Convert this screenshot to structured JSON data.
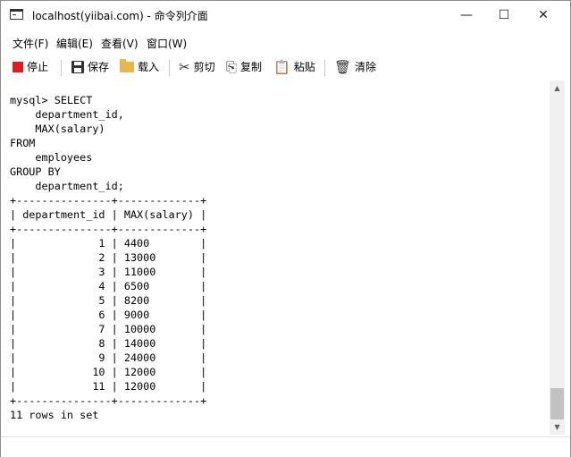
{
  "window": {
    "title": "localhost(yiibai.com) - 命令列介面",
    "minimize_glyph": "—",
    "maximize_glyph": "☐",
    "close_glyph": "✕"
  },
  "menu": {
    "items": [
      {
        "label": "文件(F)"
      },
      {
        "label": "编辑(E)"
      },
      {
        "label": "查看(V)"
      },
      {
        "label": "窗口(W)"
      }
    ]
  },
  "toolbar": {
    "stop_label": "停止",
    "save_label": "保存",
    "load_label": "载入",
    "cut_label": "剪切",
    "copy_label": "复制",
    "paste_label": "粘贴",
    "clear_label": "清除",
    "cut_icon": "✂",
    "copy_icon": "⎘",
    "paste_icon": "📋",
    "clear_icon": "🗑"
  },
  "console": {
    "lines": [
      "mysql> SELECT",
      "    department_id,",
      "    MAX(salary)",
      "FROM",
      "    employees",
      "GROUP BY",
      "    department_id;",
      "+---------------+-------------+",
      "| department_id | MAX(salary) |",
      "+---------------+-------------+",
      "|             1 | 4400        |",
      "|             2 | 13000       |",
      "|             3 | 11000       |",
      "|             4 | 6500        |",
      "|             5 | 8200        |",
      "|             6 | 9000        |",
      "|             7 | 10000       |",
      "|             8 | 14000       |",
      "|             9 | 24000       |",
      "|            10 | 12000       |",
      "|            11 | 12000       |",
      "+---------------+-------------+",
      "11 rows in set"
    ]
  },
  "scrollbar": {
    "up_glyph": "▲",
    "down_glyph": "▼"
  },
  "colors": {
    "stop_icon": "#e31b1b",
    "load_icon": "#e8b64a",
    "scroll_track": "#f0f0f0",
    "scroll_thumb": "#c2c2c2"
  }
}
